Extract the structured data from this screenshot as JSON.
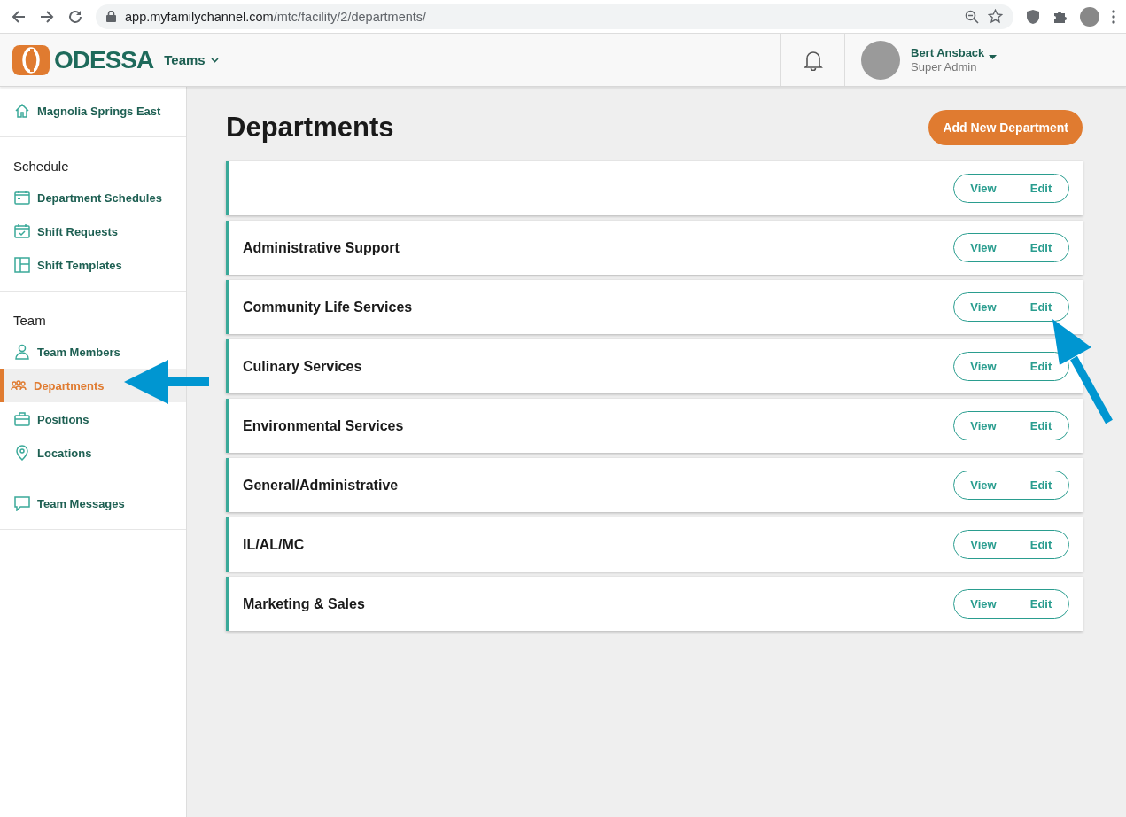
{
  "browser": {
    "url_host": "app.myfamilychannel.com",
    "url_path": "/mtc/facility/2/departments/"
  },
  "header": {
    "logo": "ODESSA",
    "menu": "Teams",
    "user": {
      "name": "Bert Ansback",
      "role": "Super Admin"
    }
  },
  "sidebar": {
    "sections": [
      {
        "items": [
          {
            "label": "Magnolia Springs East",
            "selected": false
          }
        ]
      },
      {
        "heading": "Schedule",
        "items": [
          {
            "label": "Department Schedules",
            "selected": false
          },
          {
            "label": "Shift Requests",
            "selected": false
          },
          {
            "label": "Shift Templates",
            "selected": false
          }
        ]
      },
      {
        "heading": "Team",
        "items": [
          {
            "label": "Team Members",
            "selected": false
          },
          {
            "label": "Departments",
            "selected": true
          },
          {
            "label": "Positions",
            "selected": false
          },
          {
            "label": "Locations",
            "selected": false
          }
        ]
      },
      {
        "items": [
          {
            "label": "Team Messages",
            "selected": false
          }
        ]
      }
    ]
  },
  "main": {
    "title": "Departments",
    "add_button": "Add New Department",
    "departments": [
      {
        "actions": [
          "View",
          "Edit"
        ]
      },
      {
        "name": "Administrative Support",
        "actions": [
          "View",
          "Edit"
        ]
      },
      {
        "name": "Community Life Services",
        "actions": [
          "View",
          "Edit"
        ]
      },
      {
        "name": "Culinary Services",
        "actions": [
          "View",
          "Edit"
        ]
      },
      {
        "name": "Environmental Services",
        "actions": [
          "View",
          "Edit"
        ]
      },
      {
        "name": "General/Administrative",
        "actions": [
          "View",
          "Edit"
        ]
      },
      {
        "name": "IL/AL/MC",
        "actions": [
          "View",
          "Edit"
        ]
      },
      {
        "name": "Marketing & Sales",
        "actions": [
          "View",
          "Edit"
        ]
      }
    ]
  }
}
